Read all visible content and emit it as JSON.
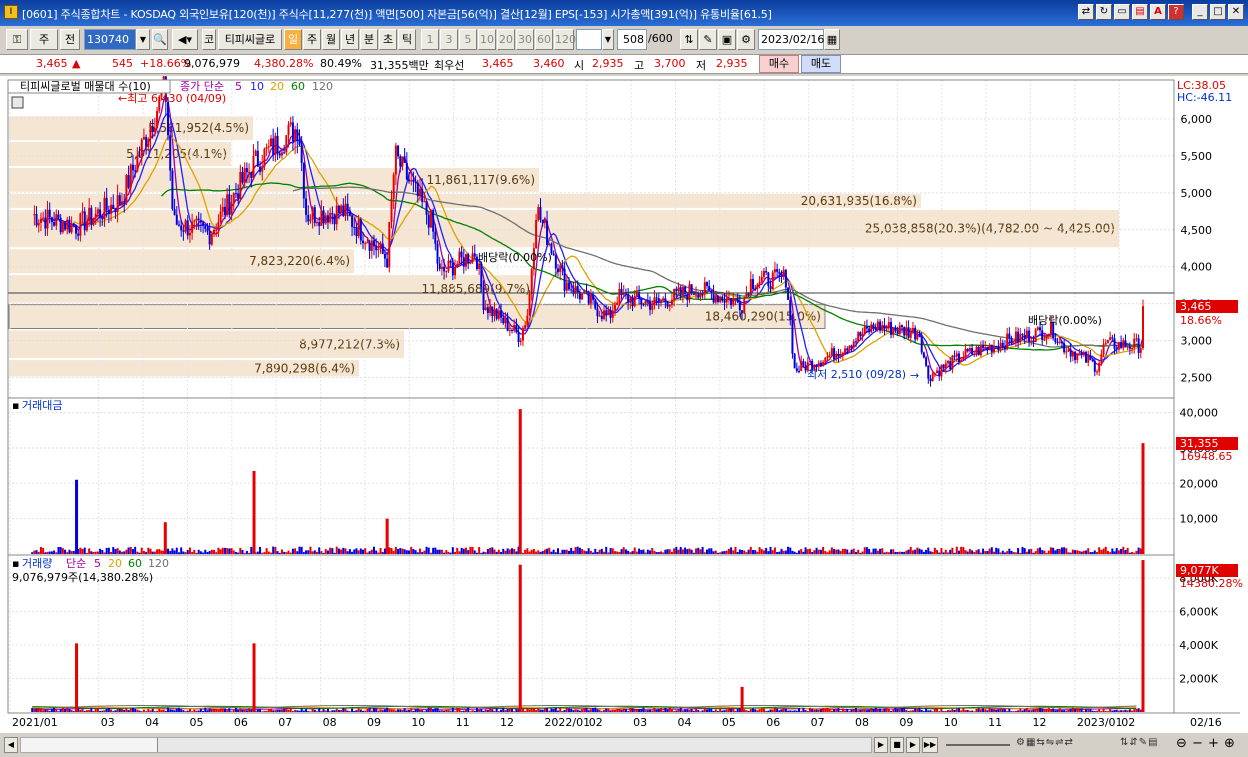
{
  "window": {
    "title": "[0601] 주식종합차트 - KOSDAQ 외국인보유[120(천)] 주식수[11,277(천)] 액면[500] 자본금[56(억)] 결산[12월] EPS[-153] 시가총액[391(억)] 유통비율[61.5]"
  },
  "toolbar": {
    "market": "주",
    "prev": "전",
    "code": "130740",
    "name_market": "코",
    "name": "티피씨글로",
    "periods": [
      "일",
      "주",
      "월",
      "년",
      "분",
      "초",
      "틱"
    ],
    "minute_options": [
      "1",
      "3",
      "5",
      "10",
      "20",
      "30",
      "60",
      "120"
    ],
    "count": "508",
    "count_total": "/600",
    "date": "2023/02/16"
  },
  "quote": {
    "price": "3,465",
    "arrow": "▲",
    "change": "545",
    "rate": "+18.66%",
    "volume": "9,076,979",
    "vol_ratio": "4,380.28%",
    "vol_pct": "80.49%",
    "amount": "31,355백만",
    "best_label": "최우선",
    "ask": "3,465",
    "bid": "3,460",
    "open_label": "시",
    "open": "2,935",
    "high_label": "고",
    "high": "3,700",
    "low_label": "저",
    "low": "2,935",
    "buy": "매수",
    "sell": "매도"
  },
  "price_panel": {
    "title": "티피씨글로벌 매물대 수(10)",
    "ma_label": "종가 단순",
    "ma_periods": [
      "5",
      "10",
      "20",
      "60",
      "120"
    ],
    "lc": "LC:38.05",
    "hc": "HC:-46.11",
    "ylim": [
      2250,
      6500
    ],
    "y_ticks": [
      "6,000",
      "5,500",
      "5,000",
      "4,500",
      "4,000",
      "3,500",
      "3,000",
      "2,500"
    ],
    "current_price": "3,465",
    "current_rate": "18.66%",
    "max_label": "←최고 6,430 (04/09)",
    "min_label": "최저 2,510 (09/28)",
    "dividend_labels": [
      "배당락(0.00%)",
      "배당락(0.00%)"
    ],
    "volume_profile": [
      {
        "label": "7,890,298(6.4%)",
        "from": 2500,
        "to": 2750
      },
      {
        "label": "8,977,212(7.3%)",
        "from": 2750,
        "to": 3150
      },
      {
        "label": "18,460,290(15.0%)",
        "from": 3150,
        "to": 3500
      },
      {
        "label": "11,885,689(9.7%)",
        "from": 3500,
        "to": 3900
      },
      {
        "label": "7,823,220(6.4%)",
        "from": 3900,
        "to": 4250
      },
      {
        "label": "25,038,858(20.3%)(4,782.00 ~ 4,425.00)",
        "from": 4250,
        "to": 4782
      },
      {
        "label": "20,631,935(16.8%)",
        "from": 4782,
        "to": 5000
      },
      {
        "label": "11,861,117(9.6%)",
        "from": 5000,
        "to": 5350
      },
      {
        "label": "5,011,205(4.1%)",
        "from": 5350,
        "to": 5700
      },
      {
        "label": "5,561,952(4.5%)",
        "from": 5700,
        "to": 6050
      }
    ]
  },
  "amount_panel": {
    "title": "거래대금",
    "y_ticks": [
      "40,000",
      "30,000",
      "20,000",
      "10,000"
    ],
    "ylim": [
      0,
      43000
    ],
    "current": "31,355",
    "ma_value": "16948.65"
  },
  "volume_panel": {
    "title": "거래량",
    "ma_label": "단순",
    "ma_periods": [
      "5",
      "20",
      "60",
      "120"
    ],
    "summary": "9,076,979주(14,380.28%)",
    "y_ticks": [
      "8,000K",
      "6,000K",
      "4,000K",
      "2,000K"
    ],
    "ylim": [
      0,
      9200000
    ],
    "current": "9,077K",
    "current_pct": "14380.28%"
  },
  "x_axis": {
    "labels": [
      "2021/01",
      "03",
      "04",
      "05",
      "06",
      "07",
      "08",
      "09",
      "10",
      "11",
      "12",
      "2022/01",
      "02",
      "03",
      "04",
      "05",
      "06",
      "07",
      "08",
      "09",
      "10",
      "11",
      "12",
      "2023/01",
      "02"
    ],
    "right_label": "02/16"
  },
  "chart_data": {
    "type": "candlestick",
    "x_range": [
      "2021/01",
      "2023/02/16"
    ],
    "ylim": [
      2250,
      6500
    ],
    "close_path": [
      [
        "2021/01",
        4700
      ],
      [
        "2021/02",
        4550
      ],
      [
        "2021/03",
        4900
      ],
      [
        "2021/04",
        6430
      ],
      [
        "2021/04",
        4600
      ],
      [
        "2021/05",
        4450
      ],
      [
        "2021/06",
        5400
      ],
      [
        "2021/07",
        5900
      ],
      [
        "2021/07",
        4700
      ],
      [
        "2021/08",
        4750
      ],
      [
        "2021/09",
        4100
      ],
      [
        "2021/09",
        5500
      ],
      [
        "2021/10",
        4600
      ],
      [
        "2021/10",
        3900
      ],
      [
        "2021/11",
        4200
      ],
      [
        "2021/11",
        3500
      ],
      [
        "2021/12",
        3050
      ],
      [
        "2021/12",
        3400
      ],
      [
        "2021/12",
        4800
      ],
      [
        "2022/01",
        3800
      ],
      [
        "2022/02",
        3300
      ],
      [
        "2022/02",
        3600
      ],
      [
        "2022/03",
        3500
      ],
      [
        "2022/04",
        3700
      ],
      [
        "2022/05",
        3500
      ],
      [
        "2022/05",
        3800
      ],
      [
        "2022/06",
        3850
      ],
      [
        "2022/06",
        2600
      ],
      [
        "2022/07",
        2800
      ],
      [
        "2022/08",
        3200
      ],
      [
        "2022/09",
        3100
      ],
      [
        "2022/09",
        2510
      ],
      [
        "2022/10",
        2800
      ],
      [
        "2022/11",
        3000
      ],
      [
        "2022/12",
        3150
      ],
      [
        "2022/12",
        2950
      ],
      [
        "2023/01",
        2650
      ],
      [
        "2023/01",
        2950
      ],
      [
        "2023/02",
        2935
      ],
      [
        "2023/02/16",
        3465
      ]
    ],
    "last_close": 3465,
    "amount_spikes": [
      [
        "2021/02",
        21000,
        "blue"
      ],
      [
        "2021/04",
        9000,
        "red"
      ],
      [
        "2021/06",
        23500,
        "red"
      ],
      [
        "2021/09",
        10000,
        "red"
      ],
      [
        "2021/12",
        41000,
        "red"
      ],
      [
        "2023/02/16",
        31355,
        "red"
      ]
    ],
    "volume_spikes": [
      [
        "2021/02",
        4100000,
        "red"
      ],
      [
        "2021/06",
        4100000,
        "red"
      ],
      [
        "2021/12",
        8800000,
        "red"
      ],
      [
        "2022/05",
        1500000,
        "red"
      ],
      [
        "2023/02/16",
        9076979,
        "red"
      ]
    ]
  },
  "colors": {
    "up": "#e80000",
    "down": "#0000e0",
    "ma5": "#a000a0",
    "ma10": "#2020ff",
    "ma20": "#e0a000",
    "ma60": "#008000",
    "ma120": "#707070",
    "profile": "#f5e6d3"
  }
}
